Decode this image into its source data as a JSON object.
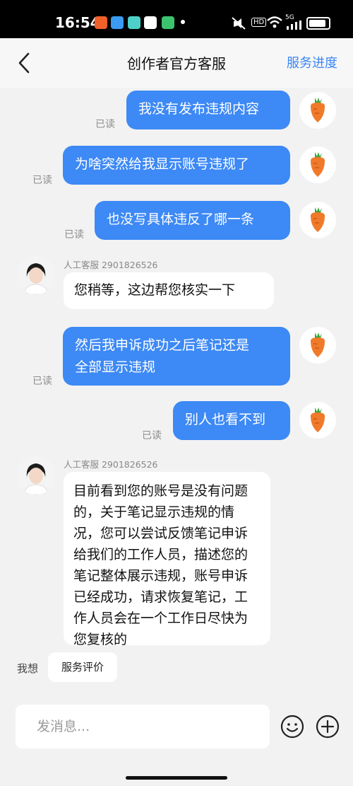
{
  "status_bar": {
    "time": "16:54",
    "hd_label": "HD",
    "signal_label": "5G",
    "battery_percent": 90,
    "app_icon_colors": [
      "#f0612a",
      "#3b9af1",
      "#4dd0c8",
      "#ffffff",
      "#3cc36e"
    ]
  },
  "header": {
    "title": "创作者官方客服",
    "action": "服务进度"
  },
  "messages": [
    {
      "side": "out",
      "text": "我没有发布违规内容",
      "read": "已读"
    },
    {
      "side": "out",
      "text": "为啥突然给我显示账号违规了",
      "read": "已读"
    },
    {
      "side": "out",
      "text": "也没写具体违反了哪一条",
      "read": "已读"
    },
    {
      "side": "in",
      "sender": "人工客服 2901826526",
      "text": "您稍等，这边帮您核实一下"
    },
    {
      "side": "out",
      "lines": [
        "然后我申诉成功之后笔记还是",
        "全部显示违规"
      ],
      "read": "已读"
    },
    {
      "side": "out",
      "text": "别人也看不到",
      "read": "已读"
    },
    {
      "side": "in",
      "sender": "人工客服 2901826526",
      "lines": [
        "目前看到您的账号是没有问题",
        "的，关于笔记显示违规的情",
        "况，您可以尝试反馈笔记申诉",
        "给我们的工作人员，描述您的",
        "笔记整体展示违规，账号申诉",
        "已经成功，请求恢复笔记，工",
        "作人员会在一个工作日尽快为",
        "您复核的"
      ]
    }
  ],
  "quick_reply": {
    "label": "我想",
    "chip": "服务评价"
  },
  "composer": {
    "placeholder": "发消息..."
  },
  "colors": {
    "accent": "#3d89f5",
    "page_bg": "#f2f2f2",
    "carrot": "#f07a2a"
  },
  "icons": [
    "back-icon",
    "carrot-avatar-icon",
    "agent-avatar-icon",
    "emoji-icon",
    "plus-icon"
  ]
}
